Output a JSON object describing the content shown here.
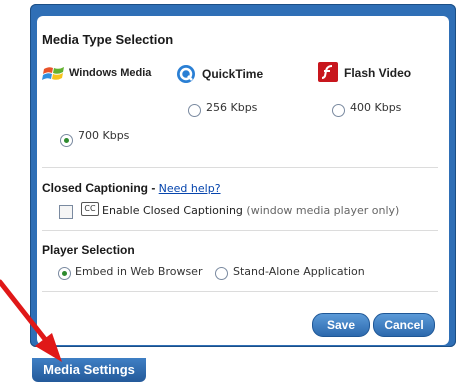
{
  "media_type": {
    "heading": "Media Type Selection",
    "players": [
      {
        "name": "Windows Media",
        "icon": "windows-media-logo-icon"
      },
      {
        "name": "QuickTime",
        "icon": "quicktime-logo-icon"
      },
      {
        "name": "Flash Video",
        "icon": "flash-logo-icon"
      }
    ],
    "options": [
      {
        "label": "256 Kbps",
        "selected": false
      },
      {
        "label": "400 Kbps",
        "selected": false
      },
      {
        "label": "700 Kbps",
        "selected": true
      }
    ]
  },
  "closed_captioning": {
    "heading": "Closed Captioning",
    "separator": " - ",
    "help_link": "Need help?",
    "cc_icon_text": "CC",
    "checkbox_label": "Enable Closed Captioning",
    "note": " (window media player only)",
    "checked": false
  },
  "player_selection": {
    "heading": "Player Selection",
    "options": [
      {
        "label": "Embed in Web Browser",
        "selected": true
      },
      {
        "label": "Stand-Alone Application",
        "selected": false
      }
    ]
  },
  "buttons": {
    "save": "Save",
    "cancel": "Cancel"
  },
  "tab": {
    "label": "Media Settings"
  },
  "colors": {
    "frame": "#2f6fb6",
    "button": "#2c69ad",
    "radio_selected": "#2e8b2e",
    "link": "#0645ad",
    "annotation_arrow": "#e01818"
  }
}
